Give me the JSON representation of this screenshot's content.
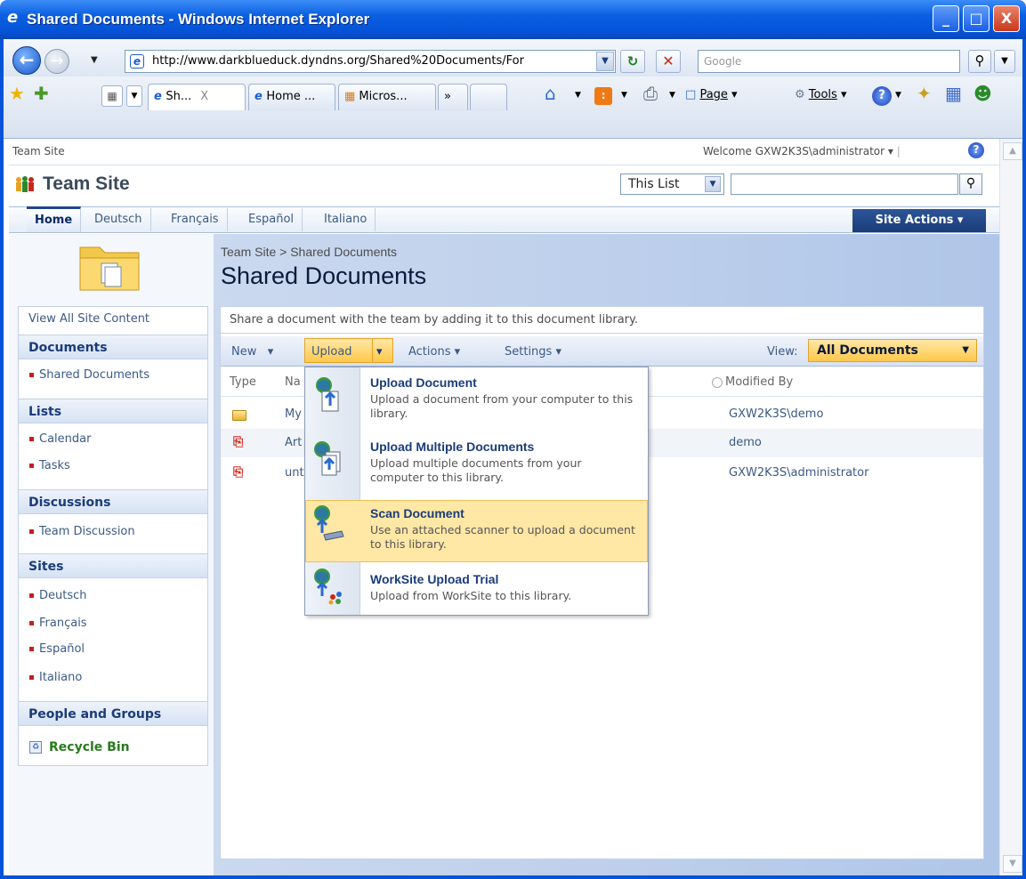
{
  "window": {
    "title": "Shared Documents - Windows Internet Explorer",
    "min": "_",
    "max": "□",
    "close": "X"
  },
  "nav": {
    "url": "http://www.darkblueduck.dyndns.org/Shared%20Documents/For",
    "search_placeholder": "Google"
  },
  "tabs": [
    {
      "label": "Sh..."
    },
    {
      "label": "Home ..."
    },
    {
      "label": "Micros..."
    },
    {
      "label": "»"
    }
  ],
  "commands": {
    "page": "Page",
    "tools": "Tools"
  },
  "sp": {
    "top_link": "Team Site",
    "welcome": "Welcome GXW2K3S\\administrator",
    "site_title": "Team Site",
    "scope": "This List",
    "topnav": [
      "Home",
      "Deutsch",
      "Français",
      "Español",
      "Italiano"
    ],
    "site_actions": "Site Actions",
    "breadcrumb": "Team Site > Shared Documents",
    "page_title": "Shared Documents"
  },
  "leftnav": {
    "view_all": "View All Site Content",
    "sections": [
      {
        "heading": "Documents",
        "items": [
          "Shared Documents"
        ]
      },
      {
        "heading": "Lists",
        "items": [
          "Calendar",
          "Tasks"
        ]
      },
      {
        "heading": "Discussions",
        "items": [
          "Team Discussion"
        ]
      },
      {
        "heading": "Sites",
        "items": [
          "Deutsch",
          "Français",
          "Español",
          "Italiano"
        ]
      },
      {
        "heading": "People and Groups",
        "items": []
      }
    ],
    "recycle_bin": "Recycle Bin"
  },
  "list": {
    "description": "Share a document with the team by adding it to this document library.",
    "toolbar": {
      "new": "New",
      "upload": "Upload",
      "actions": "Actions",
      "settings": "Settings",
      "view_label": "View:",
      "view_value": "All Documents"
    },
    "columns": {
      "type": "Type",
      "name": "Na",
      "modified_by": "Modified By"
    },
    "rows": [
      {
        "name": "My",
        "modified_by": "GXW2K3S\\demo"
      },
      {
        "name": "Art",
        "modified_by": "demo"
      },
      {
        "name": "unt",
        "modified_by": "GXW2K3S\\administrator"
      }
    ]
  },
  "upload_menu": [
    {
      "title": "Upload Document",
      "desc": "Upload a document from your computer to this library."
    },
    {
      "title": "Upload Multiple Documents",
      "desc": "Upload multiple documents from your computer to this library."
    },
    {
      "title": "Scan Document",
      "desc": "Use an attached scanner to upload a document to this library."
    },
    {
      "title": "WorkSite Upload Trial",
      "desc": "Upload from WorkSite to this library."
    }
  ]
}
